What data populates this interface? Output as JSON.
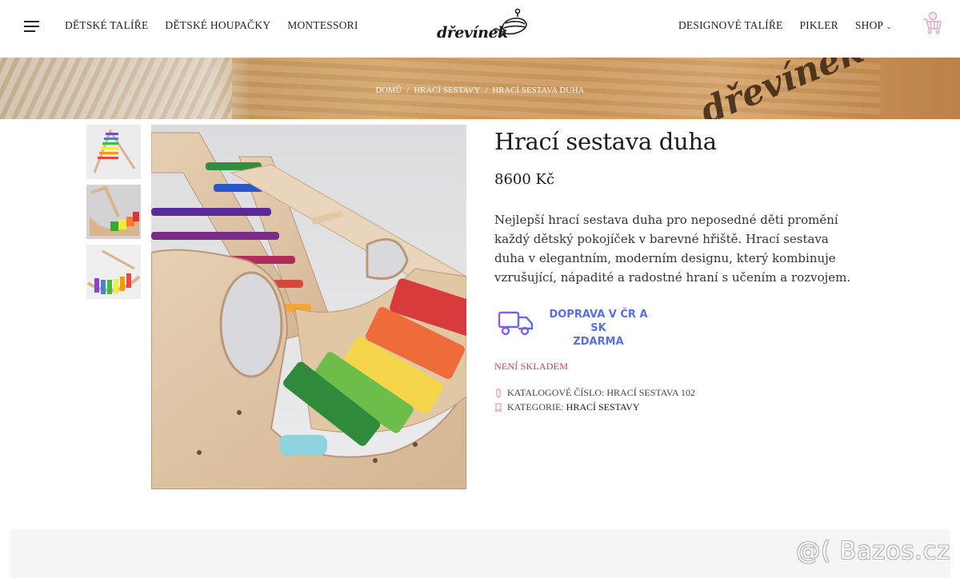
{
  "header": {
    "nav_left": [
      "DĚTSKÉ TALÍŘE",
      "DĚTSKÉ HOUPAČKY",
      "MONTESSORI"
    ],
    "nav_right": [
      "DESIGNOVÉ TALÍŘE",
      "PIKLER",
      "SHOP"
    ],
    "logo_text": "dřevínek"
  },
  "banner": {
    "script_text": "dřevínek",
    "breadcrumb": [
      "DOMŮ",
      "HRACÍ SESTAVY",
      "HRACÍ SESTAVA DUHA"
    ]
  },
  "product": {
    "title": "Hrací sestava duha",
    "price": "8600 Kč",
    "description": "Nejlepší hrací sestava duha pro neposedné děti promění každý dětský pokojíček v barevné hřiště. Hrací sestava duha v elegantním, moderním designu, který kombinuje vzrušující, nápadité a radostné hraní s učením a rozvojem.",
    "shipping_line1": "DOPRAVA V ČR A SK",
    "shipping_line2": "ZDARMA",
    "stock_status": "NENÍ SKLADEM",
    "sku_label": "KATALOGOVÉ ČÍSLO:",
    "sku_value": "HRACÍ SESTAVA 102",
    "category_label": "KATEGORIE:",
    "category_value": "HRACÍ SESTAVY"
  },
  "gallery": {
    "thumbnail_count": 3,
    "active_thumbnail": 2
  },
  "watermark": "@( Bazos.cz",
  "colors": {
    "accent_shipping": "#5a6ee3",
    "stock_red": "#c0445a",
    "footer_bg": "#f5f5f5"
  },
  "icons": [
    "menu-icon",
    "cart-icon",
    "chevron-down-icon",
    "truck-icon",
    "tag-icon",
    "bookmark-icon"
  ]
}
